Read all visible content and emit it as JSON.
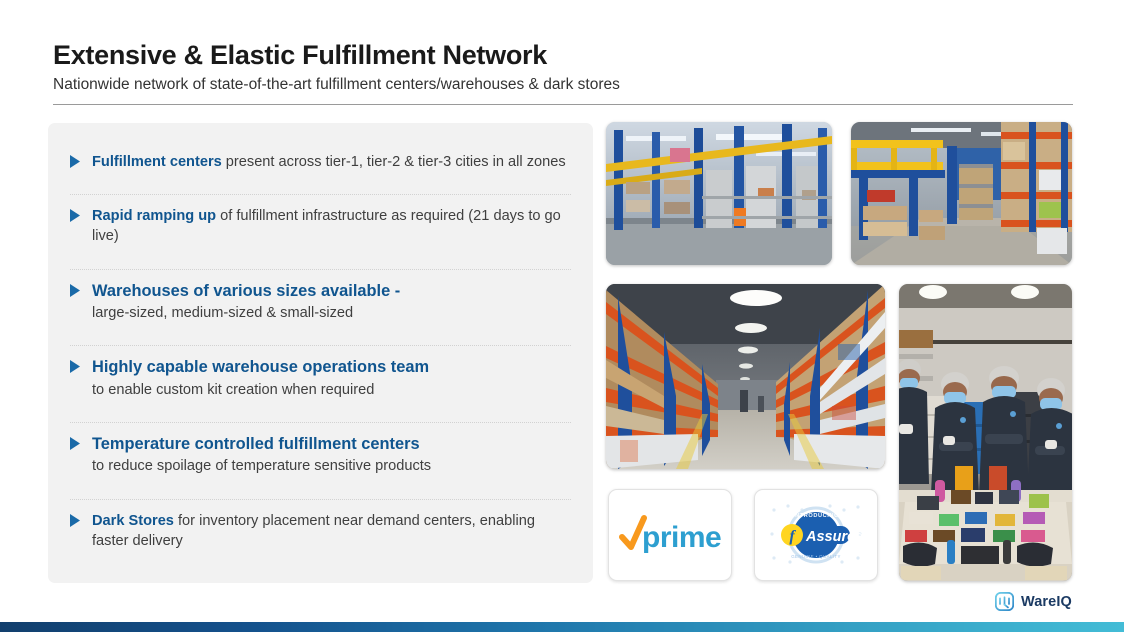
{
  "header": {
    "title": "Extensive & Elastic Fulfillment Network",
    "subtitle": "Nationwide network of state-of-the-art fulfillment centers/warehouses & dark stores"
  },
  "bullets": [
    {
      "marker": "triangle-right-icon",
      "layout": "inline",
      "lead": "Fulfillment centers",
      "rest": " present across tier-1, tier-2 & tier-3 cities in all zones"
    },
    {
      "marker": "triangle-right-icon",
      "layout": "inline",
      "lead": "Rapid ramping up",
      "rest": " of fulfillment infrastructure as required (21 days to go live)"
    },
    {
      "marker": "triangle-right-icon",
      "layout": "stacked",
      "lead": "Warehouses of various sizes available -",
      "rest": "large-sized, medium-sized & small-sized"
    },
    {
      "marker": "triangle-right-icon",
      "layout": "stacked",
      "lead": "Highly capable warehouse operations team",
      "rest": "to enable custom kit creation when required"
    },
    {
      "marker": "triangle-right-icon",
      "layout": "stacked",
      "lead": "Temperature controlled fulfillment centers",
      "rest": "to reduce spoilage of temperature sensitive products"
    },
    {
      "marker": "triangle-right-icon",
      "layout": "inline",
      "lead": "Dark Stores",
      "rest": " for inventory placement near demand centers, enabling faster delivery"
    }
  ],
  "photos": [
    {
      "name": "warehouse-blue-shelving-photo",
      "alt": "Warehouse interior with blue steel shelving racks and yellow mezzanine railings"
    },
    {
      "name": "warehouse-pallet-aisle-photo",
      "alt": "Warehouse aisle with tall pallet racks stacked with cardboard cartons"
    },
    {
      "name": "warehouse-wide-aisle-photo",
      "alt": "Wide warehouse aisle with orange beams, blue uprights and overhead lighting"
    },
    {
      "name": "warehouse-operations-team-photo",
      "alt": "Four warehouse operations staff in navy uniforms, hairnets and face masks behind a table of packaged products"
    }
  ],
  "badges": [
    {
      "name": "amazon-prime-badge",
      "label": "prime",
      "check_color": "#f8991d",
      "text_color": "#2d9fd0"
    },
    {
      "name": "flipkart-assured-badge",
      "label": "Assured",
      "kicker": "INTRODUCING",
      "mark": "f",
      "badge_color": "#1b5fb0",
      "mark_color": "#ffd520"
    }
  ],
  "brand": {
    "name": "WareIQ",
    "mark": "wareiq-cube-icon",
    "text_color": "#1b3a63"
  },
  "theme": {
    "panel_bg": "#f2f2f2",
    "accent_blue": "#10558f",
    "marker_blue": "#1a6aa8",
    "body_text": "#3f3f3f",
    "title_text": "#1a1a1a",
    "bar_gradient_start": "#123f6d",
    "bar_gradient_end": "#43bcd6"
  }
}
